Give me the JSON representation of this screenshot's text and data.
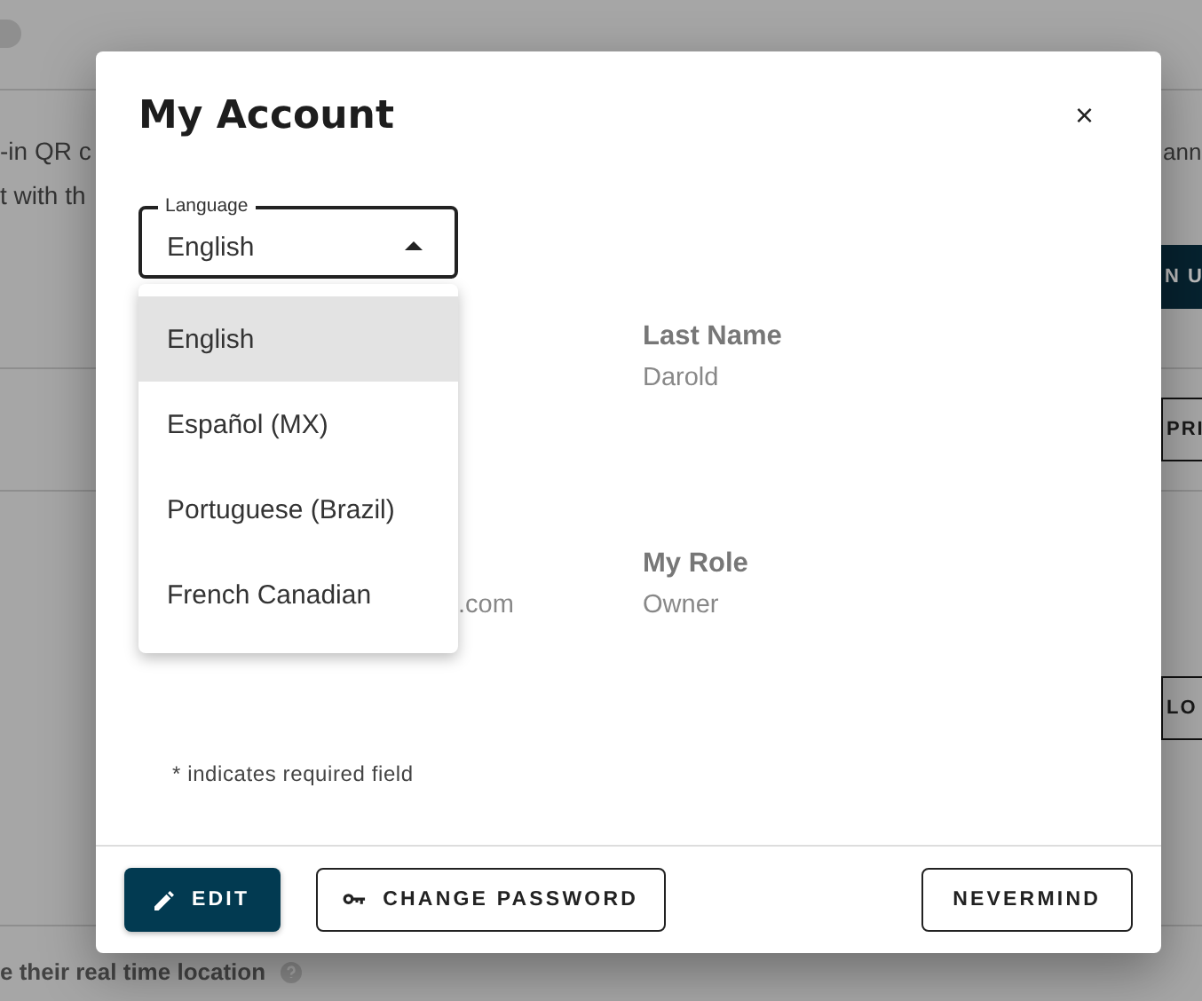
{
  "background": {
    "lines": [
      "-in QR c",
      "t with th"
    ],
    "right_text": "ann",
    "buttons": [
      {
        "label": "N U",
        "kind": "filled"
      },
      {
        "label": "PRI",
        "kind": "outlined"
      },
      {
        "label": "LO",
        "kind": "outlined"
      }
    ],
    "footer_text": "e their real time location"
  },
  "dialog": {
    "title": "My Account",
    "close": "×",
    "language": {
      "label": "Language",
      "value": "English",
      "expanded": true,
      "options": [
        {
          "label": "English",
          "selected": true
        },
        {
          "label": "Español (MX)",
          "selected": false
        },
        {
          "label": "Portuguese (Brazil)",
          "selected": false
        },
        {
          "label": "French Canadian",
          "selected": false
        }
      ]
    },
    "field_rows": [
      {
        "right": {
          "label": "Last Name",
          "value": "Darold"
        }
      },
      {
        "left": {
          "value": ".com"
        },
        "right": {
          "label": "My Role",
          "value": "Owner"
        }
      }
    ],
    "note": "* indicates required field",
    "buttons": [
      {
        "label": "EDIT",
        "kind": "edit"
      },
      {
        "label": "CHANGE PASSWORD",
        "kind": "password"
      },
      {
        "label": "NEVERMIND",
        "kind": "cancel"
      }
    ]
  }
}
